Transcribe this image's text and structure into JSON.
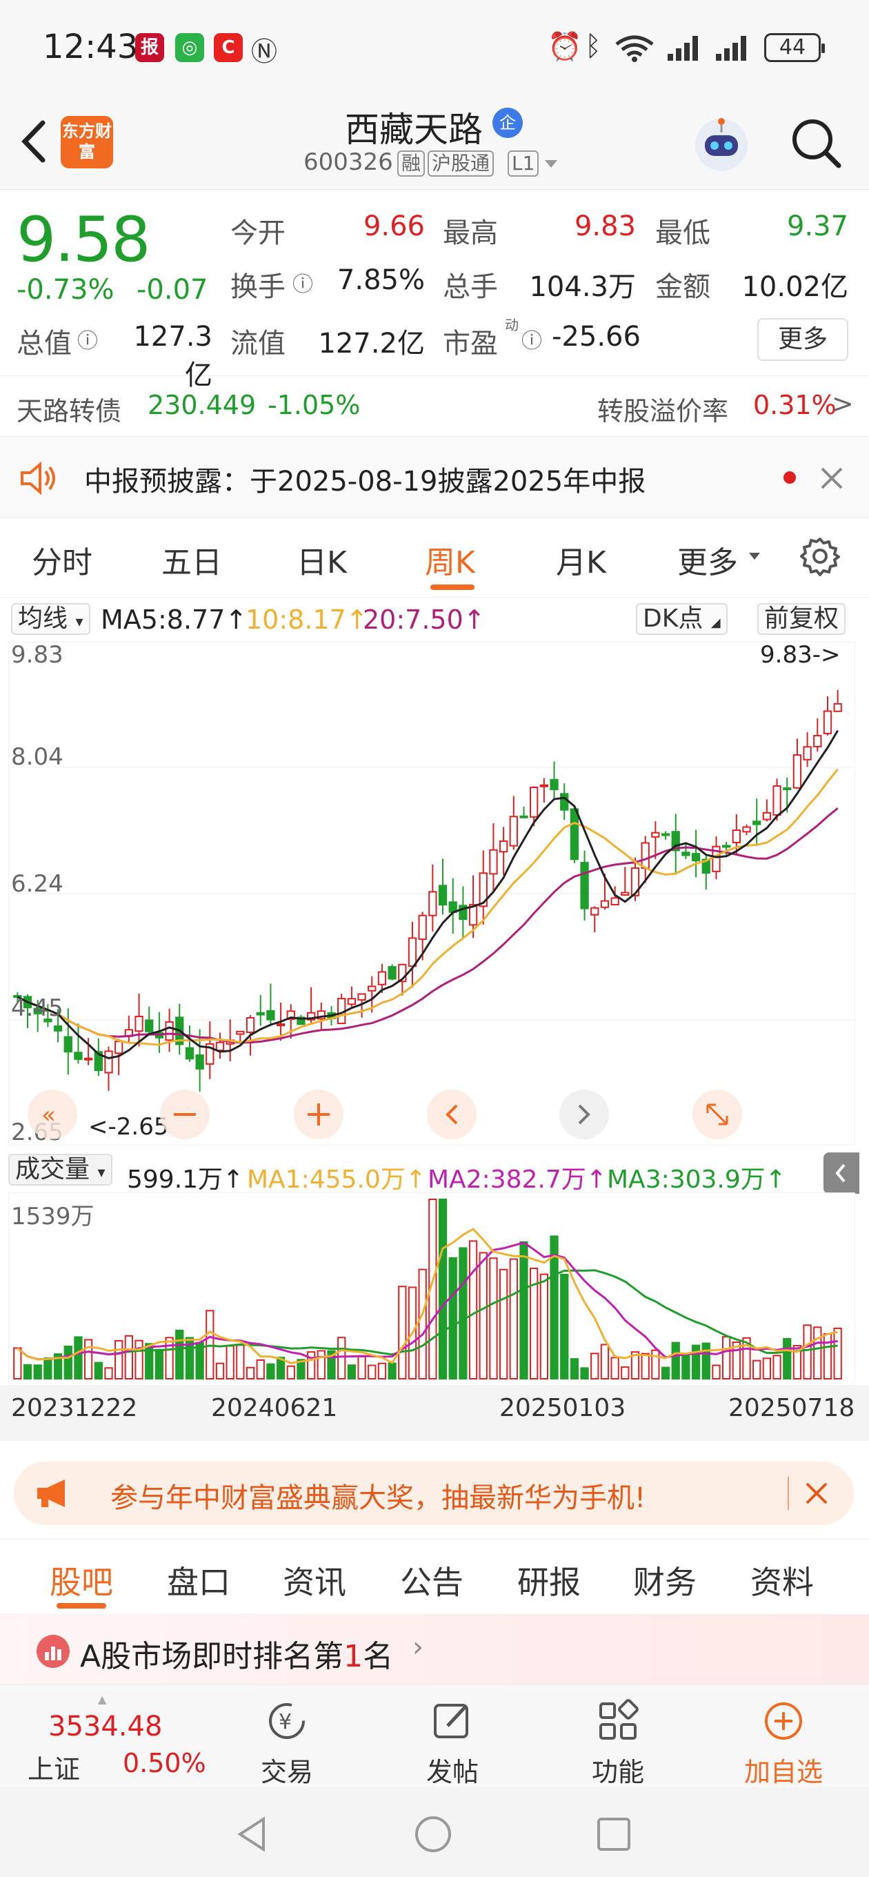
{
  "status_bar": {
    "time": "12:43",
    "battery": "44"
  },
  "header": {
    "logo_text": "东方财富",
    "stock_name": "西藏天路",
    "name_badge": "企",
    "stock_code": "600326",
    "tags": [
      "融",
      "沪股通",
      "L1"
    ]
  },
  "quote": {
    "price": "9.58",
    "change_pct": "-0.73%",
    "change_abs": "-0.07",
    "fields": {
      "open_label": "今开",
      "open": "9.66",
      "high_label": "最高",
      "high": "9.83",
      "low_label": "最低",
      "low": "9.37",
      "turnover_label": "换手",
      "turnover": "7.85%",
      "volume_label": "总手",
      "volume": "104.3万",
      "amount_label": "金额",
      "amount": "10.02亿",
      "mktcap_label": "总值",
      "mktcap": "127.3亿",
      "float_label": "流值",
      "float": "127.2亿",
      "pe_label": "市盈",
      "pe_sup": "动",
      "pe": "-25.66"
    },
    "more_label": "更多"
  },
  "conv_bond": {
    "name": "天路转债",
    "price": "230.449",
    "change": "-1.05%",
    "premium_label": "转股溢价率",
    "premium": "0.31%"
  },
  "notice": {
    "text": "中报预披露：于2025-08-19披露2025年中报"
  },
  "chart_tabs": [
    "分时",
    "五日",
    "日K",
    "周K",
    "月K",
    "更多"
  ],
  "active_chart_tab": "周K",
  "ma_row": {
    "selector": "均线",
    "ma5": "MA5:8.77↑",
    "ma10": "10:8.17↑",
    "ma20": "20:7.50↑",
    "dk_label": "DK点",
    "adjust_label": "前复权"
  },
  "price_axis": [
    "9.83",
    "8.04",
    "6.24",
    "4.45",
    "2.65"
  ],
  "high_marker": "9.83->",
  "low_marker": "<-2.65",
  "volume_row": {
    "selector": "成交量",
    "current": "599.1万↑",
    "ma1": "MA1:455.0万↑",
    "ma2": "MA2:382.7万↑",
    "ma3": "MA3:303.9万↑",
    "max_label": "1539万"
  },
  "date_axis": [
    "20231222",
    "20240621",
    "20250103",
    "20250718"
  ],
  "promo": {
    "text": "参与年中财富盛典赢大奖，抽最新华为手机!"
  },
  "sub_tabs": [
    "股吧",
    "盘口",
    "资讯",
    "公告",
    "研报",
    "财务",
    "资料"
  ],
  "active_sub_tab": "股吧",
  "rank_text": {
    "prefix": "A股市场即时排名第",
    "rank": "1",
    "suffix": "名"
  },
  "bottom_nav": {
    "index_value": "3534.48",
    "index_name": "上证",
    "index_change": "0.50%",
    "trade": "交易",
    "post": "发帖",
    "functions": "功能",
    "add_watch": "加自选"
  },
  "colors": {
    "up": "#e02020",
    "down": "#1e9e2a",
    "accent": "#f06a21",
    "ma5": "#222222",
    "ma10": "#f0b030",
    "ma20": "#b0207a"
  }
}
